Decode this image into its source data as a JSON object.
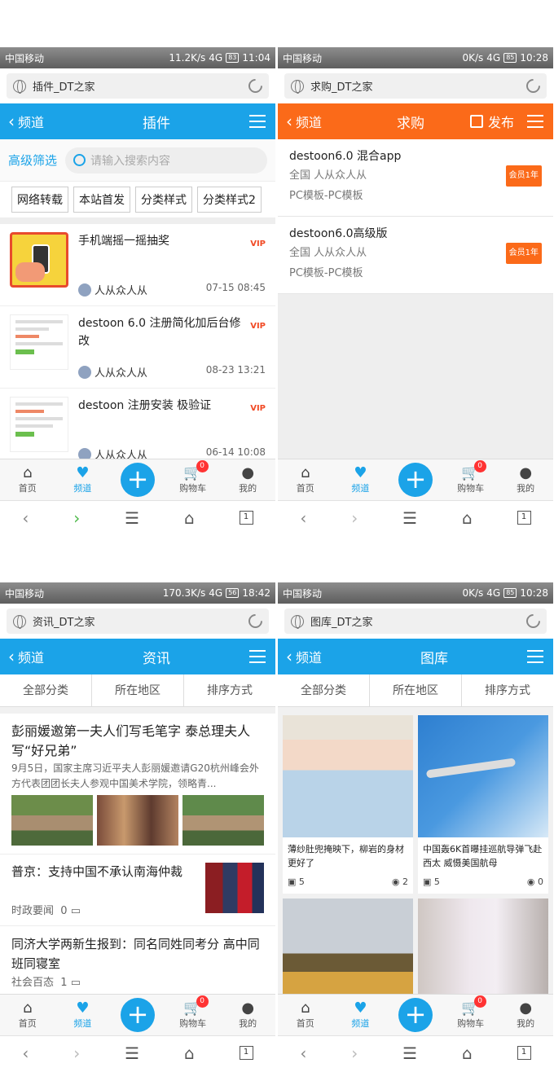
{
  "screens": [
    {
      "status": {
        "carrier": "中国移动",
        "speed": "11.2K/s",
        "net": "4G",
        "battery": "83",
        "time": "11:04"
      },
      "url_title": "插件_DT之家",
      "back_label": "频道",
      "header_title": "插件",
      "search": {
        "advanced": "高级筛选",
        "placeholder": "请输入搜索内容"
      },
      "tags": [
        "网络转载",
        "本站首发",
        "分类样式",
        "分类样式2"
      ],
      "items": [
        {
          "title": "手机端摇一摇抽奖",
          "badge": "VIP",
          "user": "人从众人从",
          "date": "07-15 08:45"
        },
        {
          "title": "destoon 6.0 注册简化加后台修改",
          "badge": "VIP",
          "user": "人从众人从",
          "date": "08-23 13:21"
        },
        {
          "title": "destoon 注册安装 极验证",
          "badge": "VIP",
          "user": "人从众人从",
          "date": "06-14 10:08"
        }
      ]
    },
    {
      "status": {
        "carrier": "中国移动",
        "speed": "0K/s",
        "net": "4G",
        "battery": "85",
        "time": "10:28"
      },
      "url_title": "求购_DT之家",
      "back_label": "频道",
      "header_title": "求购",
      "publish_label": "发布",
      "items": [
        {
          "title": "destoon6.0 混合app",
          "region": "全国 人从众人从",
          "badge": "会员1年",
          "category": "PC模板-PC模板"
        },
        {
          "title": "destoon6.0高级版",
          "region": "全国 人从众人从",
          "badge": "会员1年",
          "category": "PC模板-PC模板"
        }
      ]
    },
    {
      "status": {
        "carrier": "中国移动",
        "speed": "170.3K/s",
        "net": "4G",
        "battery": "56",
        "time": "18:42"
      },
      "url_title": "资讯_DT之家",
      "back_label": "频道",
      "header_title": "资讯",
      "filters": [
        "全部分类",
        "所在地区",
        "排序方式"
      ],
      "news": [
        {
          "title": "彭丽媛邀第一夫人们写毛笔字 泰总理夫人写“好兄弟”",
          "desc": "9月5日，国家主席习近平夫人彭丽媛邀请G20杭州峰会外方代表团团长夫人参观中国美术学院，领略青..."
        },
        {
          "title": "普京：支持中国不承认南海仲裁",
          "category": "时政要闻",
          "comments": "0"
        },
        {
          "title": "同济大学两新生报到：同名同姓同考分 高中同班同寝室",
          "category": "社会百态",
          "comments": "1"
        }
      ]
    },
    {
      "status": {
        "carrier": "中国移动",
        "speed": "0K/s",
        "net": "4G",
        "battery": "85",
        "time": "10:28"
      },
      "url_title": "图库_DT之家",
      "back_label": "频道",
      "header_title": "图库",
      "filters": [
        "全部分类",
        "所在地区",
        "排序方式"
      ],
      "gallery": [
        {
          "title": "薄纱肚兜掩映下，柳岩的身材更好了",
          "photos": "5",
          "views": "2"
        },
        {
          "title": "中国轰6K首曝挂巡航导弹飞赴西太 威慑美国航母",
          "photos": "5",
          "views": "0"
        }
      ]
    }
  ],
  "bottom_nav": {
    "home": "首页",
    "channel": "频道",
    "plus": "+",
    "cart": "购物车",
    "cart_badge": "0",
    "mine": "我的"
  },
  "browser_nav": {
    "back": "‹",
    "forward": "›",
    "menu": "☰",
    "home": "⌂",
    "tabs": "1"
  },
  "colors": {
    "blue": "#1ba3e8",
    "orange": "#fb6a19",
    "vip": "#f14a25"
  }
}
